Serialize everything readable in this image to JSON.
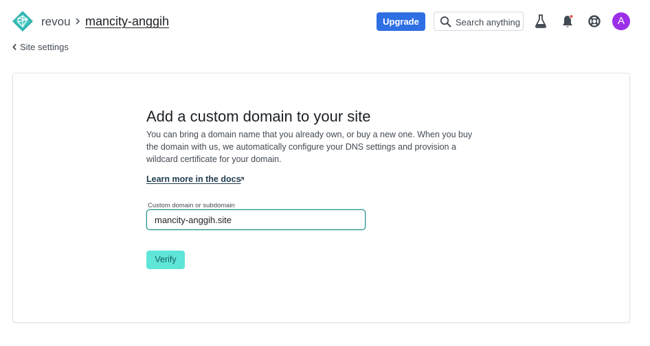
{
  "header": {
    "logo_icon": "netlify-logo-icon",
    "team_name": "revou",
    "separator_icon": "chevron-right-icon",
    "site_name": "mancity-anggih",
    "upgrade_label": "Upgrade",
    "search_label": "Search anything",
    "search_icon": "search-icon",
    "icons": [
      "flask-icon",
      "bell-icon",
      "lifebuoy-icon"
    ],
    "notification_dot_color": "#e05a4f",
    "avatar_initial": "A",
    "avatar_color": "#9b30e8",
    "upgrade_color": "#2f6fe4"
  },
  "back_link": {
    "label": "Site settings",
    "icon": "chevron-left-icon"
  },
  "card": {
    "title": "Add a custom domain to your site",
    "description": "You can bring a domain name that you already own, or buy a new one. When you buy the domain with us, we automatically configure your DNS settings and provision a wildcard certificate for your domain.",
    "docs_link_label": "Learn more in the docs",
    "docs_link_icon": "external-link-icon",
    "field_label": "Custom domain or subdomain",
    "field_value": "mancity-anggih.site",
    "verify_label": "Verify",
    "verify_color": "#5fe6d8"
  }
}
